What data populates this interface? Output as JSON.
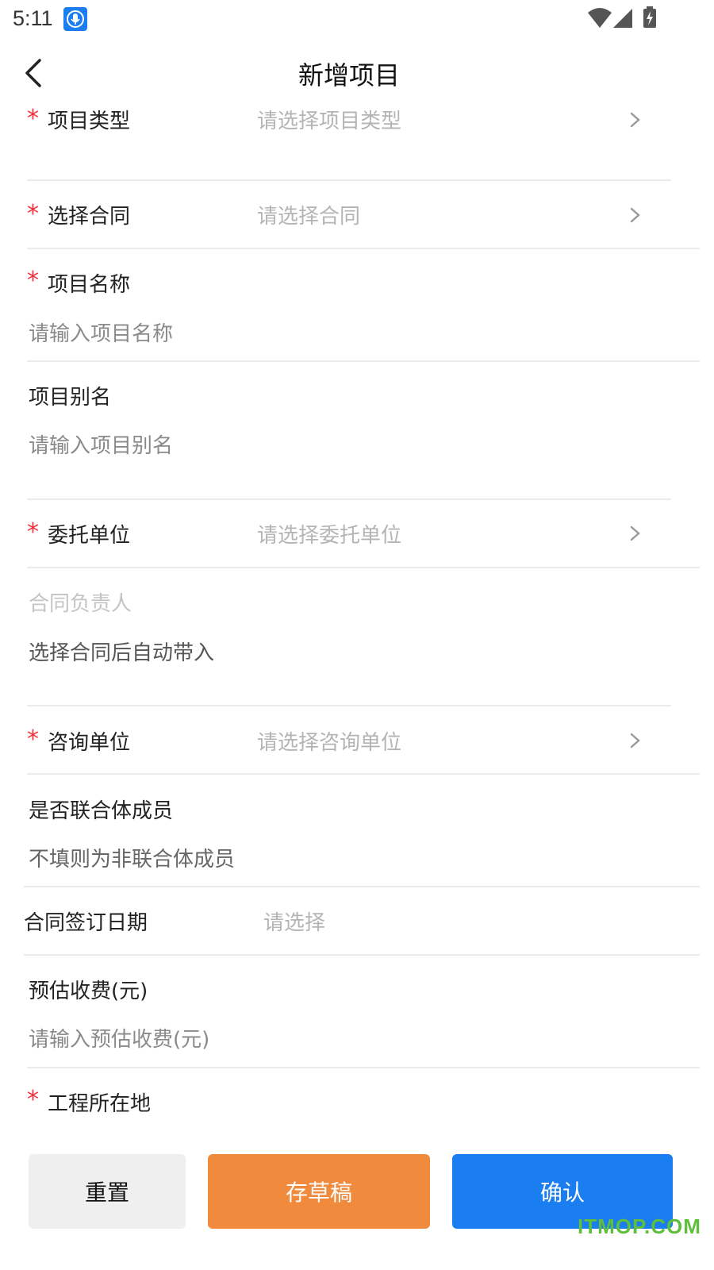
{
  "status_bar": {
    "time": "5:11",
    "icons": [
      "microphone-icon",
      "wifi-icon",
      "signal-icon",
      "battery-charging-icon"
    ]
  },
  "header": {
    "title": "新增项目",
    "back_icon": "chevron-left-icon"
  },
  "form": {
    "project_type": {
      "label": "项目类型",
      "required": "*",
      "placeholder": "请选择项目类型"
    },
    "contract": {
      "label": "选择合同",
      "required": "*",
      "placeholder": "请选择合同"
    },
    "project_name": {
      "label": "项目名称",
      "required": "*",
      "placeholder": "请输入项目名称"
    },
    "project_alias": {
      "label": "项目别名",
      "placeholder": "请输入项目别名"
    },
    "client_unit": {
      "label": "委托单位",
      "required": "*",
      "placeholder": "请选择委托单位"
    },
    "contract_owner": {
      "label": "合同负责人",
      "value": "选择合同后自动带入"
    },
    "consult_unit": {
      "label": "咨询单位",
      "required": "*",
      "placeholder": "请选择咨询单位"
    },
    "consortium": {
      "label": "是否联合体成员",
      "value": "不填则为非联合体成员"
    },
    "sign_date": {
      "label": "合同签订日期",
      "placeholder": "请选择"
    },
    "estimated_fee": {
      "label": "预估收费(元)",
      "placeholder": "请输入预估收费(元)"
    },
    "location": {
      "label": "工程所在地",
      "required": "*"
    }
  },
  "buttons": {
    "reset": "重置",
    "draft": "存草稿",
    "confirm": "确认"
  },
  "watermark": "ITMOP.COM",
  "colors": {
    "required": "#f0313d",
    "draft": "#f08a3c",
    "confirm": "#1a7df0",
    "reset": "#efefef",
    "placeholder": "#b4b4b4"
  }
}
